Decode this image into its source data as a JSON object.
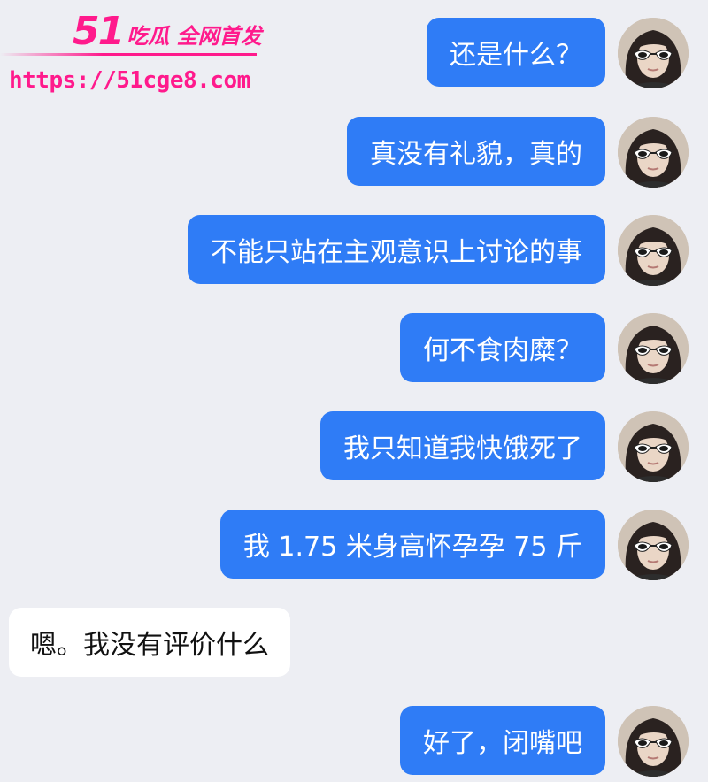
{
  "watermark": {
    "brand_number": "51",
    "brand_text": "吃瓜 全网首发",
    "url": "https://51cge8.com"
  },
  "messages": [
    {
      "sender": "me",
      "text": "还是什么？"
    },
    {
      "sender": "me",
      "text": "真没有礼貌，真的"
    },
    {
      "sender": "me",
      "text": "不能只站在主观意识上讨论的事"
    },
    {
      "sender": "me",
      "text": "何不食肉糜？"
    },
    {
      "sender": "me",
      "text": "我只知道我快饿死了"
    },
    {
      "sender": "me",
      "text": "我 1.75 米身高怀孕孕 75 斤"
    },
    {
      "sender": "them",
      "text": "嗯。我没有评价什么"
    },
    {
      "sender": "me",
      "text": "好了，闭嘴吧"
    }
  ],
  "colors": {
    "background": "#edeef3",
    "outgoing_bubble": "#2f7cf6",
    "incoming_bubble": "#ffffff",
    "watermark": "#ff1a8c"
  },
  "icons": {
    "avatar": "user-avatar-sunglasses"
  }
}
